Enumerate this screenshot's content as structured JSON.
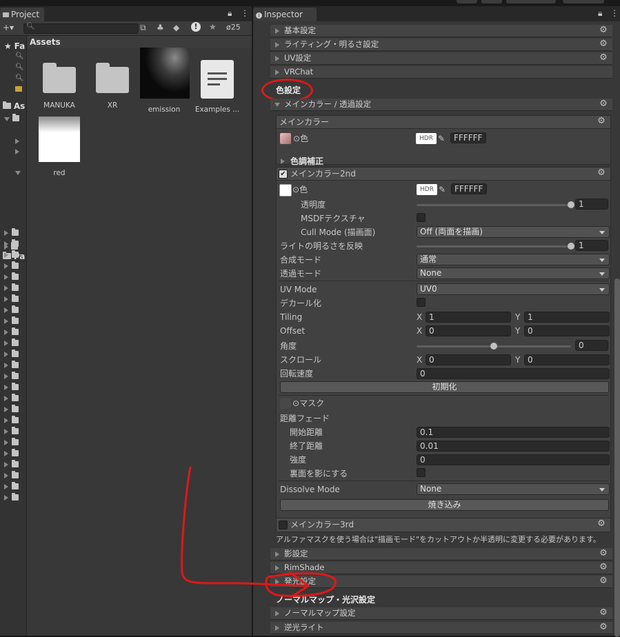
{
  "project": {
    "tab_title": "Project",
    "hidden_count": "25",
    "assets_header": "Assets",
    "tree_labels": {
      "favorites": "Fa",
      "assets": "As",
      "packages": "Pa"
    },
    "items": [
      {
        "name": "MANUKA",
        "kind": "folder"
      },
      {
        "name": "XR",
        "kind": "folder"
      },
      {
        "name": "emission",
        "kind": "texture-black"
      },
      {
        "name": "Examples ...",
        "kind": "document"
      },
      {
        "name": "red",
        "kind": "texture-white"
      }
    ]
  },
  "inspector": {
    "tab_title": "Inspector",
    "top_sections": [
      "基本設定",
      "ライティング・明るさ設定",
      "UV設定",
      "VRChat"
    ],
    "color_section_title": "色設定",
    "main_color_header": "メインカラー / 透過設定",
    "main_color_box": {
      "title": "メインカラー",
      "color_label": "色",
      "hdr": "HDR",
      "hex": "FFFFFF",
      "adjust_label": "色調補正"
    },
    "main_color_2nd": {
      "title": "メインカラー2nd",
      "color_label": "色",
      "hdr": "HDR",
      "hex": "FFFFFF",
      "opacity_label": "透明度",
      "opacity_value": "1",
      "opacity_level": 1.0,
      "msdf_label": "MSDFテクスチャ",
      "cull_label": "Cull Mode (描画面)",
      "cull_value": "Off (両面を描画)",
      "light_label": "ライトの明るさを反映",
      "light_value": "1",
      "light_level": 1.0,
      "blend_label": "合成モード",
      "blend_value": "通常",
      "alpha_label": "透過モード",
      "alpha_value": "None",
      "uvmode_label": "UV Mode",
      "uvmode_value": "UV0",
      "decal_label": "デカール化",
      "tiling_label": "Tiling",
      "tiling_x": "1",
      "tiling_y": "1",
      "offset_label": "Offset",
      "offset_x": "0",
      "offset_y": "0",
      "angle_label": "角度",
      "angle_value": "0",
      "angle_level": 0.5,
      "scroll_label": "スクロール",
      "scroll_x": "0",
      "scroll_y": "0",
      "rotspeed_label": "回転速度",
      "rotspeed_value": "0",
      "reset_button": "初期化",
      "mask_label": "マスク",
      "fade_label": "距離フェード",
      "fade_start_label": "開始距離",
      "fade_start_value": "0.1",
      "fade_end_label": "終了距離",
      "fade_end_value": "0.01",
      "strength_label": "強度",
      "strength_value": "0",
      "backface_label": "裏面を影にする",
      "dissolve_label": "Dissolve Mode",
      "dissolve_value": "None",
      "bake_button": "焼き込み",
      "axis_x": "X",
      "axis_y": "Y"
    },
    "main_color_3rd": {
      "title": "メインカラー3rd"
    },
    "alpha_mask_note": "アルファマスクを使う場合は\"描画モード\"をカットアウトか半透明に変更する必要があります。",
    "lower_sections": [
      "影設定",
      "RimShade",
      "発光設定"
    ],
    "normal_section_title": "ノーマルマップ・光沢設定",
    "normal_sections": [
      "ノーマルマップ設定",
      "逆光ライト"
    ]
  },
  "colors": {
    "annotation_red": "#e01818",
    "panel_bg": "#383838",
    "header_bg": "#444444"
  }
}
